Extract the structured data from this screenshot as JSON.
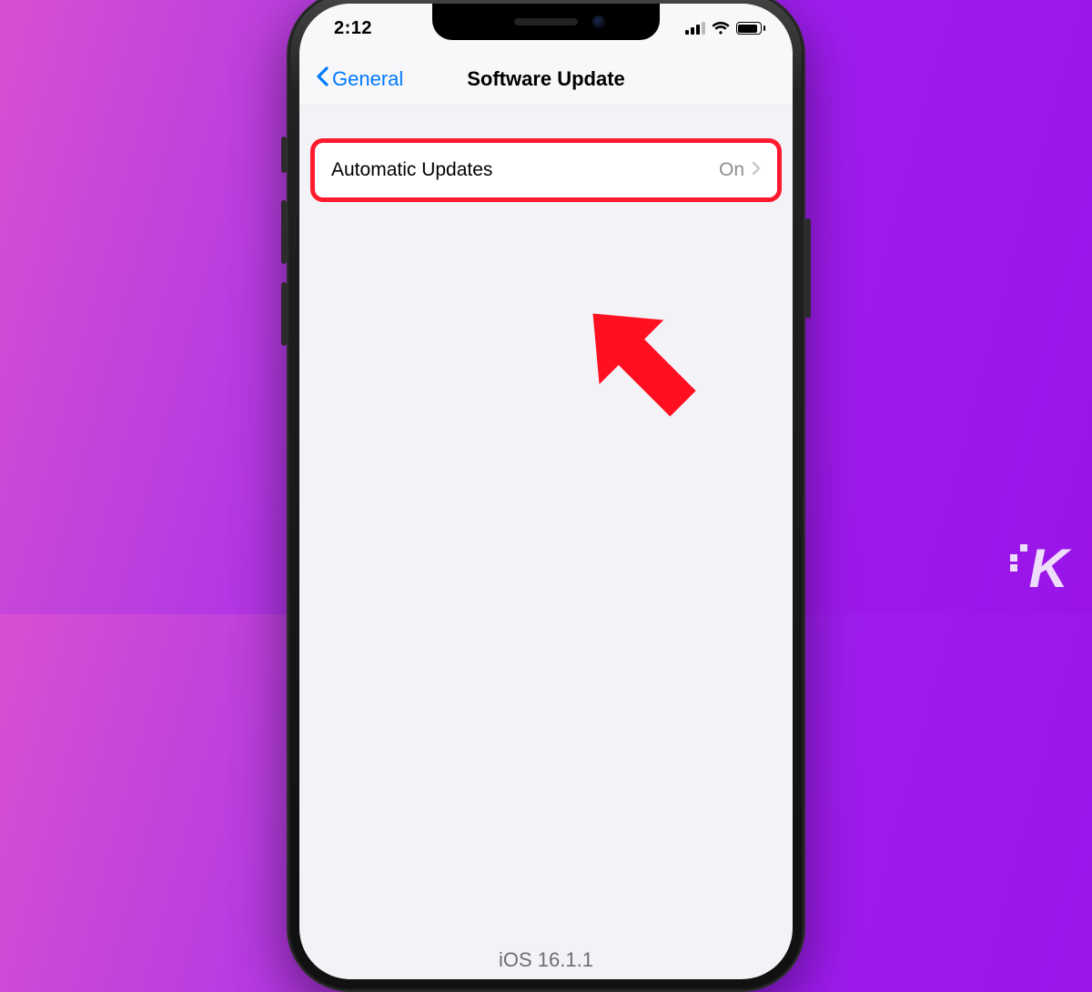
{
  "status_bar": {
    "time": "2:12"
  },
  "nav": {
    "back_label": "General",
    "title": "Software Update"
  },
  "rows": {
    "automatic_updates": {
      "label": "Automatic Updates",
      "value": "On"
    }
  },
  "footer": {
    "ios_version": "iOS 16.1.1"
  },
  "annotations": {
    "highlight_color": "#ff1a2e"
  },
  "watermark": {
    "letter": "K"
  }
}
